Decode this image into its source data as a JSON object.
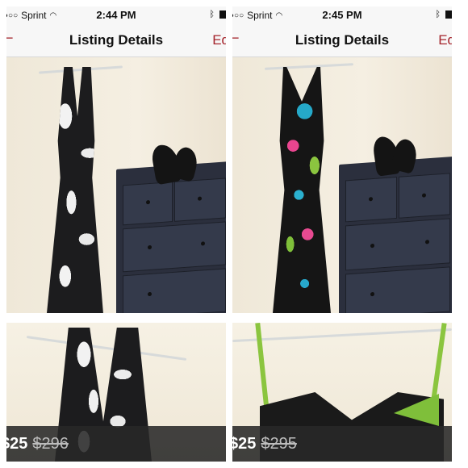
{
  "panels": [
    {
      "status": {
        "carrier": "Sprint",
        "time": "2:44 PM"
      },
      "nav": {
        "back_label": "−",
        "title": "Listing Details",
        "edit_label": "Ed"
      },
      "price": {
        "current": "$25",
        "original": "$296"
      }
    },
    {
      "status": {
        "carrier": "Sprint",
        "time": "2:45 PM"
      },
      "nav": {
        "back_label": "−",
        "title": "Listing Details",
        "edit_label": "Ed"
      },
      "price": {
        "current": "$25",
        "original": "$295"
      }
    }
  ],
  "colors": {
    "accent": "#a4232b",
    "price_bar": "#282828",
    "dresser": "#2b2f3d",
    "wall": "#f2ecdf"
  }
}
